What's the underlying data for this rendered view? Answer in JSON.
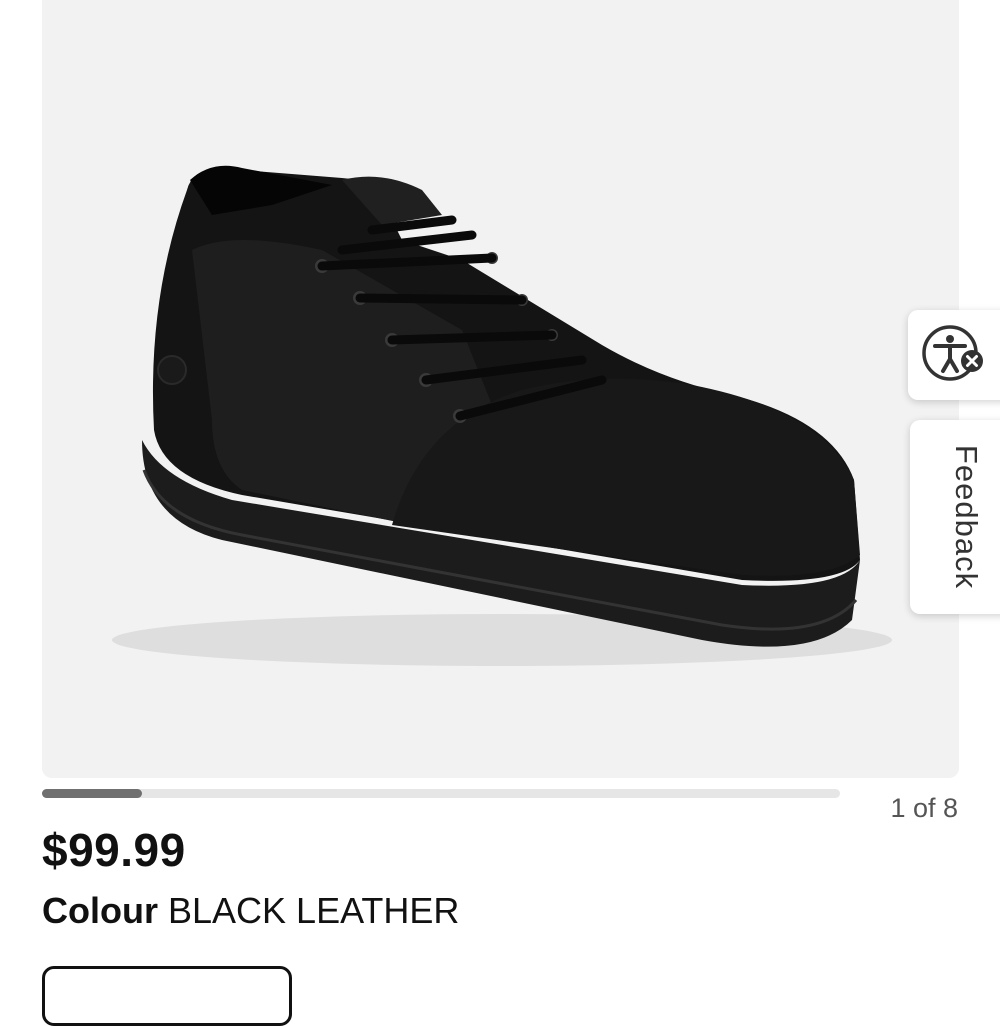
{
  "gallery": {
    "counter": "1 of 8",
    "current_slide": 1,
    "total_slides": 8,
    "progress_fraction": 0.125
  },
  "product": {
    "price": "$99.99",
    "colour_label": "Colour",
    "colour_value": "BLACK LEATHER"
  },
  "side_tabs": {
    "accessibility_icon": "accessibility-person-icon",
    "feedback_label": "Feedback"
  },
  "colors": {
    "gallery_bg": "#f2f2f2",
    "progress_fill": "#707070",
    "text": "#111111"
  }
}
